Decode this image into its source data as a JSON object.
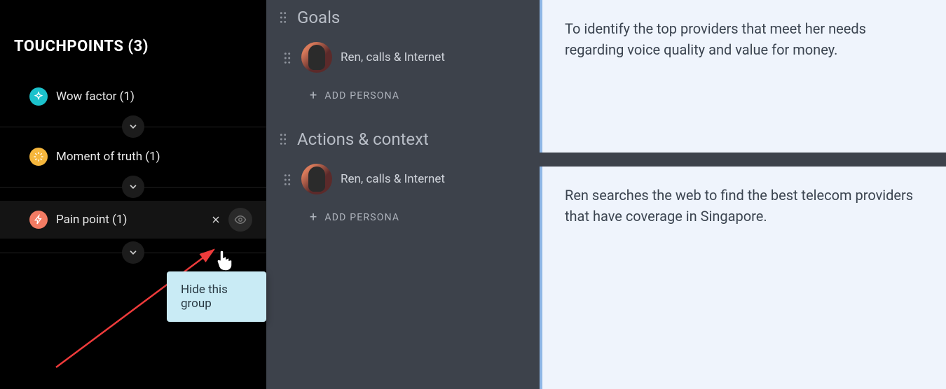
{
  "sidebar": {
    "title": "TOUCHPOINTS (3)",
    "items": [
      {
        "label": "Wow factor (1)",
        "iconColor": "#1cc2cc"
      },
      {
        "label": "Moment of truth (1)",
        "iconColor": "#f5b63c"
      },
      {
        "label": "Pain point (1)",
        "iconColor": "#f37b63"
      }
    ]
  },
  "tooltip": {
    "text": "Hide this group"
  },
  "sections": [
    {
      "title": "Goals",
      "persona": "Ren, calls & Internet",
      "addLabel": "ADD PERSONA",
      "body": "To identify the top providers that meet her needs regarding voice quality and value for money."
    },
    {
      "title": "Actions & context",
      "persona": "Ren, calls & Internet",
      "addLabel": "ADD PERSONA",
      "body": "Ren searches the web to find the best telecom providers that have coverage in Singapore."
    }
  ]
}
